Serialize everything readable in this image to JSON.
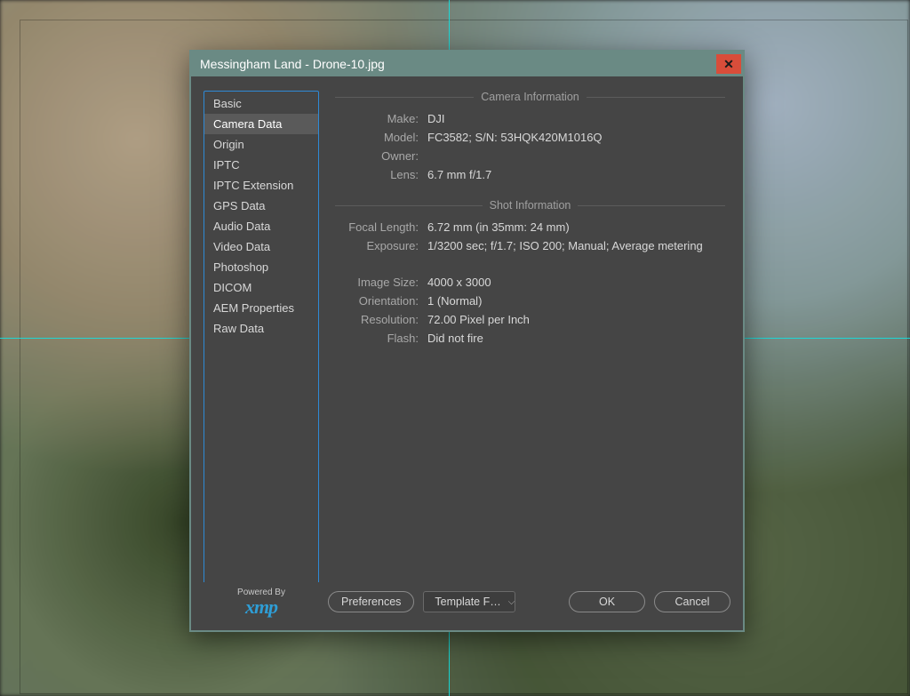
{
  "dialog": {
    "title": "Messingham Land - Drone-10.jpg",
    "close": "✕"
  },
  "sidebar": {
    "items": [
      "Basic",
      "Camera Data",
      "Origin",
      "IPTC",
      "IPTC Extension",
      "GPS Data",
      "Audio Data",
      "Video Data",
      "Photoshop",
      "DICOM",
      "AEM Properties",
      "Raw Data"
    ],
    "selected_index": 1
  },
  "sections": {
    "camera_info": {
      "heading": "Camera Information",
      "make_label": "Make:",
      "make": "DJI",
      "model_label": "Model:",
      "model": "FC3582;   S/N: 53HQK420M1016Q",
      "owner_label": "Owner:",
      "owner": "",
      "lens_label": "Lens:",
      "lens": "6.7 mm f/1.7"
    },
    "shot_info": {
      "heading": "Shot Information",
      "focal_label": "Focal Length:",
      "focal": "6.72 mm   (in 35mm: 24 mm)",
      "exposure_label": "Exposure:",
      "exposure": "1/3200 sec;   f/1.7;   ISO 200;   Manual;   Average metering",
      "size_label": "Image Size:",
      "size": "4000 x 3000",
      "orient_label": "Orientation:",
      "orient": "1 (Normal)",
      "res_label": "Resolution:",
      "res": "72.00 Pixel per Inch",
      "flash_label": "Flash:",
      "flash": "Did not fire"
    }
  },
  "footer": {
    "powered_by": "Powered By",
    "xmp": "xmp",
    "preferences": "Preferences",
    "template": "Template F…",
    "ok": "OK",
    "cancel": "Cancel"
  }
}
